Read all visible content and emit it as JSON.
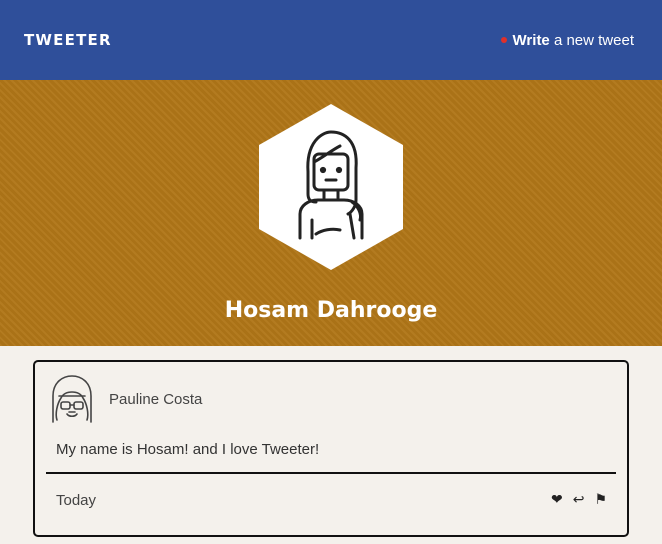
{
  "nav": {
    "brand": "TWEETER",
    "compose_bold": "Write",
    "compose_rest": " a new tweet"
  },
  "profile": {
    "name": "Hosam Dahrooge"
  },
  "tweet": {
    "author": "Pauline Costa",
    "text": "My name is Hosam! and I love Tweeter!",
    "date": "Today",
    "actions": [
      {
        "name": "heart-icon",
        "glyph": "❤"
      },
      {
        "name": "reply-icon",
        "glyph": "↩"
      },
      {
        "name": "flag-icon",
        "glyph": "⚑"
      }
    ]
  },
  "colors": {
    "nav": "#2f4f9a",
    "hero": "#b07618",
    "accent_dot": "#e0302a",
    "page": "#f4f1ec"
  }
}
